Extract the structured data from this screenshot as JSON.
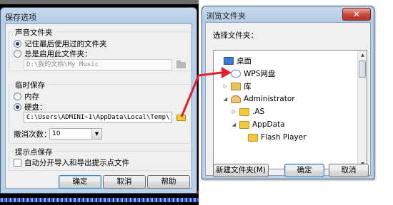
{
  "save_dialog": {
    "title": "保存选项",
    "close_glyph": "✕",
    "sound_group": {
      "title": "声音文件夹",
      "options": [
        "记住最后使用过的文件夹",
        "总是启用此文件夹："
      ],
      "selected_index": 0,
      "path_value": "D:\\我的文档\\My Music"
    },
    "temp_group": {
      "title": "临时保存",
      "options": [
        "内存",
        "硬盘："
      ],
      "selected_index": 1,
      "path_value": "C:\\Users\\ADMINI~1\\AppData\\Local\\Temp\\",
      "undo_label": "撤消次数：",
      "undo_value": "10"
    },
    "cue_group": {
      "title": "提示点保存",
      "checkbox_label": "自动分开导入和导出提示点文件",
      "checked": false
    },
    "buttons": {
      "ok": "确定",
      "cancel": "取消",
      "help": "帮助"
    }
  },
  "browse_dialog": {
    "title": "浏览文件夹",
    "close_glyph": "✕",
    "prompt": "选择文件夹：",
    "tree": [
      {
        "label": "桌面",
        "icon": "desktop-icon",
        "level": 0,
        "expander": ""
      },
      {
        "label": "WPS网盘",
        "icon": "cloud-icon",
        "level": 1,
        "expander": ""
      },
      {
        "label": "库",
        "icon": "library-icon",
        "level": 1,
        "expander": "▷"
      },
      {
        "label": "Administrator",
        "icon": "user-icon",
        "level": 1,
        "expander": "◢"
      },
      {
        "label": ".AS",
        "icon": "folder-icon",
        "level": 2,
        "expander": "▷"
      },
      {
        "label": "AppData",
        "icon": "folder-icon",
        "level": 2,
        "expander": "◢"
      },
      {
        "label": "Flash Player",
        "icon": "folder-icon",
        "level": 3,
        "expander": ""
      }
    ],
    "buttons": {
      "new_folder": "新建文件夹(M)",
      "ok": "确定",
      "cancel": "取消"
    }
  },
  "colors": {
    "arrow": "#e0202a",
    "title_bar": "#b9d1ea",
    "selection": "#cde8ff"
  }
}
